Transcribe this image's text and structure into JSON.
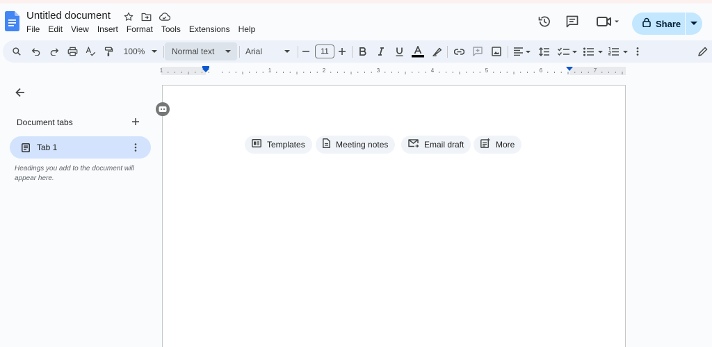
{
  "document": {
    "title": "Untitled document"
  },
  "menu": [
    "File",
    "Edit",
    "View",
    "Insert",
    "Format",
    "Tools",
    "Extensions",
    "Help"
  ],
  "header": {
    "share_label": "Share",
    "icons": [
      "star-icon",
      "move-to-folder-icon",
      "cloud-saved-icon",
      "version-history-icon",
      "comments-icon",
      "meet-icon",
      "lock-icon"
    ]
  },
  "toolbar": {
    "zoom": "100%",
    "paragraph_style": "Normal text",
    "font_family": "Arial",
    "font_size": "11",
    "colors": {
      "text_color_bar": "#000000",
      "accent": "#0b57d0"
    }
  },
  "sidebar": {
    "heading": "Document tabs",
    "tabs": [
      {
        "label": "Tab 1"
      }
    ],
    "hint": "Headings you add to the document will appear here."
  },
  "ruler": {
    "numbers": [
      "1",
      "1",
      "2",
      "3",
      "4",
      "5",
      "6",
      "7"
    ]
  },
  "chips": [
    {
      "label": "Templates",
      "icon": "templates-icon"
    },
    {
      "label": "Meeting notes",
      "icon": "document-icon"
    },
    {
      "label": "Email draft",
      "icon": "email-icon"
    },
    {
      "label": "More",
      "icon": "more-icon"
    }
  ]
}
